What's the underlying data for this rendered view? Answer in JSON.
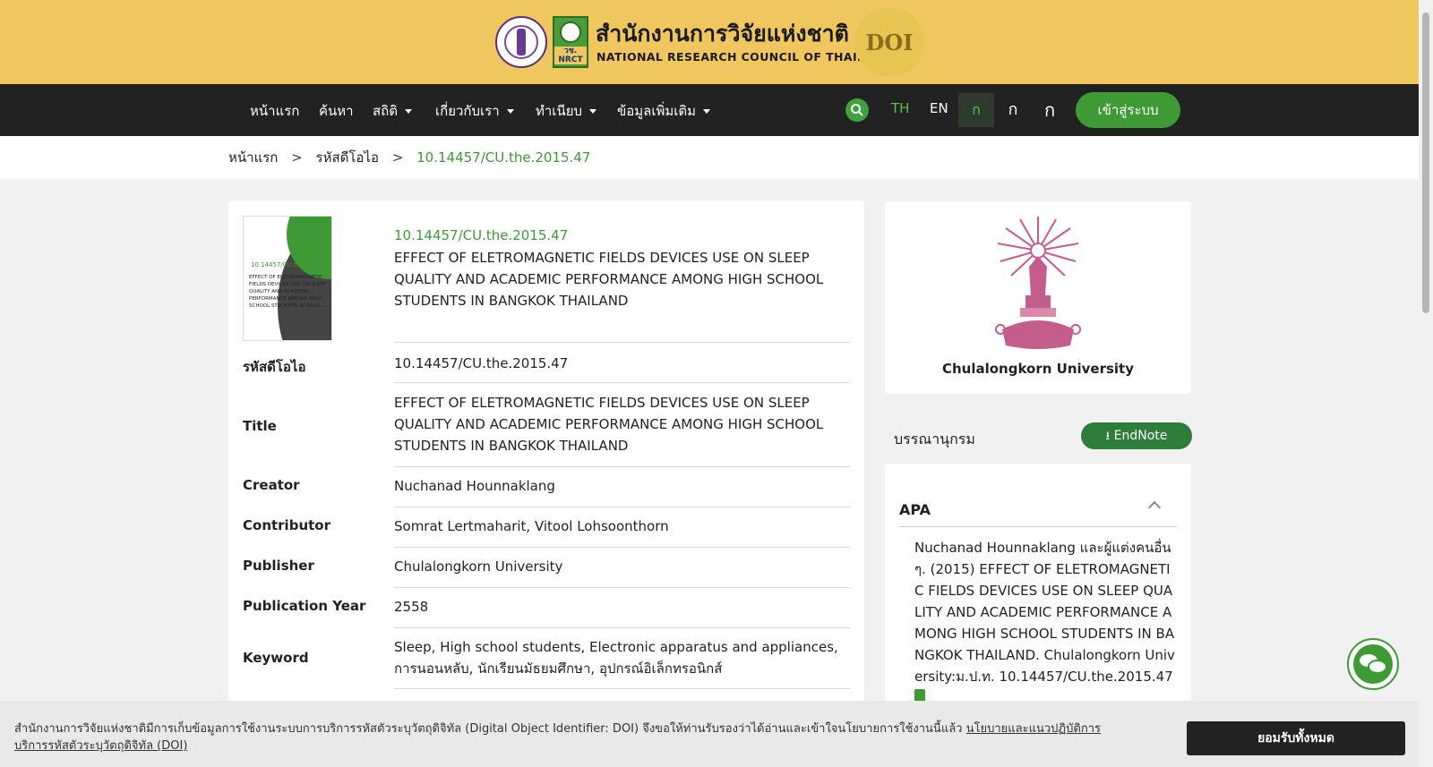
{
  "header": {
    "site_name_th": "สำนักงานการวิจัยแห่งชาติ",
    "site_name_en": "NATIONAL RESEARCH COUNCIL OF THAILAND",
    "logo_badge": "วช. NRCT",
    "doi_badge": "DOI"
  },
  "nav": {
    "items": [
      "หน้าแรก",
      "ค้นหา",
      "สถิติ",
      "เกี่ยวกับเรา",
      "ทำเนียบ",
      "ข้อมูลเพิ่มเติม"
    ],
    "lang_th": "TH",
    "lang_en": "EN",
    "font_sizes": [
      "ก",
      "ก",
      "ก"
    ],
    "login_label": "เข้าสู่ระบบ"
  },
  "breadcrumb": {
    "home": "หน้าแรก",
    "section": "รหัสดีโอไอ",
    "current": "10.14457/CU.the.2015.47",
    "sep": ">"
  },
  "record": {
    "thumb_doi": "10.14457/CU.the.2015.47",
    "thumb_title": "EFFECT OF ELETROMAGNETIC FIELDS DEVICES USE ON SLEEP QUALITY AND ACADEMIC PERFORMANCE AMONG HIGH SCHOOL STUDENTS IN BANG...",
    "doi": "10.14457/CU.the.2015.47",
    "title": "EFFECT OF ELETROMAGNETIC FIELDS DEVICES USE ON SLEEP QUALITY AND ACADEMIC PERFORMANCE AMONG HIGH SCHOOL STUDENTS IN BANGKOK THAILAND",
    "fields": {
      "doi_label": "รหัสดีโอไอ",
      "doi_value": "10.14457/CU.the.2015.47",
      "title_label": "Title",
      "title_value": "EFFECT OF ELETROMAGNETIC FIELDS DEVICES USE ON SLEEP QUALITY AND ACADEMIC PERFORMANCE AMONG HIGH SCHOOL STUDENTS IN BANGKOK THAILAND",
      "creator_label": "Creator",
      "creator_value": "Nuchanad Hounnaklang",
      "contributor_label": "Contributor",
      "contributor_value": "Somrat Lertmaharit, Vitool Lohsoonthorn",
      "publisher_label": "Publisher",
      "publisher_value": "Chulalongkorn University",
      "year_label": "Publication Year",
      "year_value": "2558",
      "keyword_label": "Keyword",
      "keyword_value": "Sleep, High school students, Electronic apparatus and appliances, การนอนหลับ, นักเรียนมัธยมศึกษา, อุปกรณ์อิเล็กทรอนิกส์"
    }
  },
  "sidebar": {
    "university": "Chulalongkorn University",
    "bibliography_label": "บรรณานุกรม",
    "endnote_label": "EndNote",
    "apa_label": "APA",
    "apa_text": "Nuchanad Hounnaklang และผู้แต่งคนอื่นๆ. (2015) EFFECT OF ELETROMAGNETIC FIELDS DEVICES USE ON SLEEP QUALITY AND ACADEMIC PERFORMANCE AMONG HIGH SCHOOL STUDENTS IN BANGKOK THAILAND. Chulalongkorn University:ม.ป.ท. 10.14457/CU.the.2015.47"
  },
  "cookie": {
    "text": "สำนักงานการวิจัยแห่งชาติมีการเก็บข้อมูลการใช้งานระบบการบริการรหัสตัวระบุวัตถุดิจิทัล (Digital Object Identifier: DOI) จึงขอให้ท่านรับรองว่าได้อ่านและเข้าใจนโยบายการใช้งานนี้แล้ว",
    "link": "นโยบายและแนวปฏิบัติการบริการรหัสตัวระบุวัตถุดิจิทัล (DOI)",
    "accept_label": "ยอมรับทั้งหมด"
  }
}
